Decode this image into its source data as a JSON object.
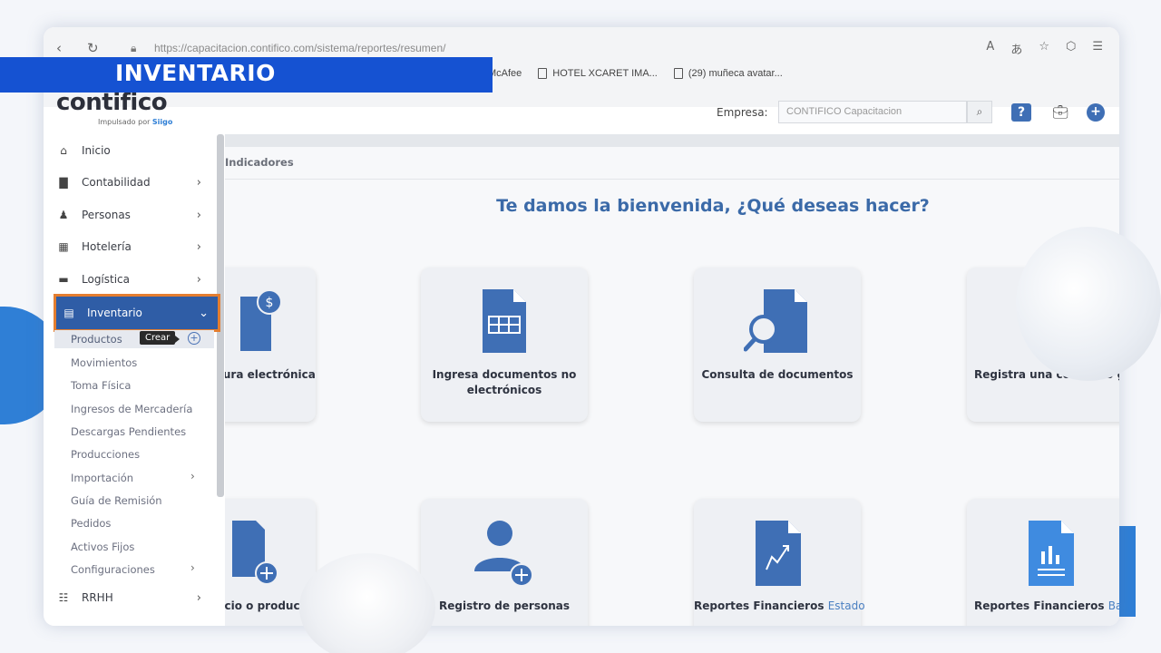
{
  "banner": {
    "title": "INVENTARIO"
  },
  "browser": {
    "url": "https://capacitacion.contifico.com/sistema/reportes/resumen/",
    "bookmarks": [
      "McAfee",
      "HOTEL XCARET IMA...",
      "(29) muñeca avatar..."
    ]
  },
  "header": {
    "logo": "contifico",
    "logo_sub_prefix": "Impulsado por",
    "logo_sub_brand": "Siigo",
    "empresa_label": "Empresa:",
    "empresa_value": "CONTIFICO Capacitacion"
  },
  "sidebar": {
    "items": [
      {
        "label": "Inicio",
        "icon": "home-icon"
      },
      {
        "label": "Contabilidad",
        "icon": "book-icon"
      },
      {
        "label": "Personas",
        "icon": "people-icon"
      },
      {
        "label": "Hotelería",
        "icon": "building-icon"
      },
      {
        "label": "Logística",
        "icon": "box-icon"
      },
      {
        "label": "Inventario",
        "icon": "clipboard-icon"
      },
      {
        "label": "RRHH",
        "icon": "team-icon"
      }
    ],
    "submenu": [
      "Productos",
      "Movimientos",
      "Toma Física",
      "Ingresos de Mercadería",
      "Descargas Pendientes",
      "Producciones",
      "Importación",
      "Guía de Remisión",
      "Pedidos",
      "Activos Fijos",
      "Configuraciones"
    ],
    "tooltip": "Crear"
  },
  "main": {
    "tab": "Indicadores",
    "welcome": "Te damos la bienvenida, ¿Qué deseas hacer?",
    "cards_row1": [
      {
        "label": "tura electrónica"
      },
      {
        "label": "Ingresa documentos no electrónicos"
      },
      {
        "label": "Consulta de documentos"
      },
      {
        "label": "Registra una compra o ga"
      }
    ],
    "cards_row2": [
      {
        "label": "icio o producto"
      },
      {
        "label": "Registro de personas"
      },
      {
        "label_main": "Reportes Financieros",
        "label_hl": "Estado"
      },
      {
        "label_main": "Reportes Financieros",
        "label_hl": "Bala"
      }
    ]
  },
  "colors": {
    "accent": "#3f6fb5",
    "banner": "#1552d2",
    "active_outline": "#e47e30"
  }
}
